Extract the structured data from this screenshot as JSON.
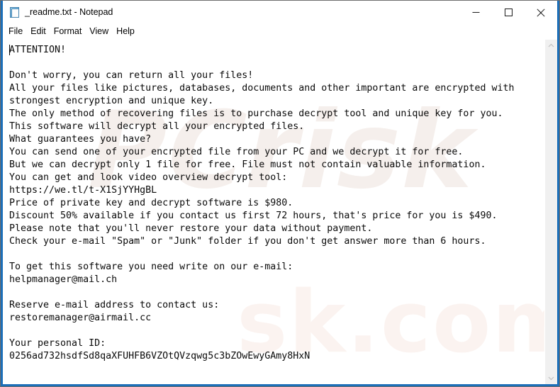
{
  "window": {
    "title": "_readme.txt - Notepad",
    "app_icon": "notepad-document-icon",
    "accent_border_color": "#1d6fb8",
    "controls": {
      "minimize": "Minimize",
      "maximize": "Maximize",
      "close": "Close"
    }
  },
  "menubar": {
    "items": [
      {
        "label": "File"
      },
      {
        "label": "Edit"
      },
      {
        "label": "Format"
      },
      {
        "label": "View"
      },
      {
        "label": "Help"
      }
    ]
  },
  "editor": {
    "filename": "_readme.txt",
    "content": "ATTENTION!\n\nDon't worry, you can return all your files!\nAll your files like pictures, databases, documents and other important are encrypted with\nstrongest encryption and unique key.\nThe only method of recovering files is to purchase decrypt tool and unique key for you.\nThis software will decrypt all your encrypted files.\nWhat guarantees you have?\nYou can send one of your encrypted file from your PC and we decrypt it for free.\nBut we can decrypt only 1 file for free. File must not contain valuable information.\nYou can get and look video overview decrypt tool:\nhttps://we.tl/t-X1SjYYHgBL\nPrice of private key and decrypt software is $980.\nDiscount 50% available if you contact us first 72 hours, that's price for you is $490.\nPlease note that you'll never restore your data without payment.\nCheck your e-mail \"Spam\" or \"Junk\" folder if you don't get answer more than 6 hours.\n\nTo get this software you need write on our e-mail:\nhelpmanager@mail.ch\n\nReserve e-mail address to contact us:\nrestoremanager@airmail.cc\n\nYour personal ID:\n0256ad732hsdfSd8qaXFUHFB6VZOtQVzqwg5c3bZOwEwyGAmy8HxN",
    "details": {
      "heading": "ATTENTION!",
      "video_url": "https://we.tl/t-X1SjYYHgBL",
      "price": "$980",
      "discount_price": "$490",
      "discount_percent": "50%",
      "discount_window": "72 hours",
      "response_time": "6 hours",
      "primary_email": "helpmanager@mail.ch",
      "reserve_email": "restoremanager@airmail.cc",
      "personal_id": "0256ad732hsdfSd8qaXFUHFB6VZOtQVzqwg5c3bZOwEwyGAmy8HxN",
      "free_file_count": "1"
    }
  },
  "watermark": {
    "line1": "PCrisk",
    "line2": "sk.com"
  },
  "scrollbar": {
    "up_arrow": "scroll-up-icon",
    "down_arrow": "scroll-down-icon"
  }
}
